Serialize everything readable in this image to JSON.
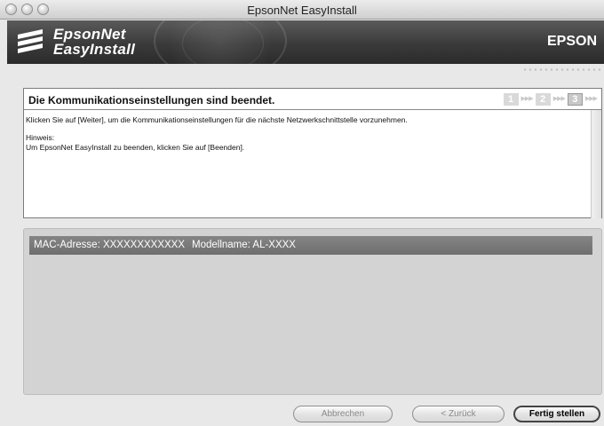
{
  "window": {
    "title": "EpsonNet EasyInstall"
  },
  "banner": {
    "brand_line1": "EpsonNet",
    "brand_line2": "EasyInstall",
    "vendor": "EPSON"
  },
  "panel": {
    "heading": "Die Kommunikationseinstellungen sind beendet.",
    "steps": [
      "1",
      "2",
      "3"
    ],
    "active_step": 3,
    "text_line1": "Klicken Sie auf [Weiter], um die Kommunikationseinstellungen für die nächste Netzwerkschnittstelle vorzunehmen.",
    "note_label": "Hinweis:",
    "note_text": "Um EpsonNet EasyInstall zu beenden, klicken Sie auf [Beenden]."
  },
  "device": {
    "mac": "MAC-Adresse: XXXXXXXXXXXX",
    "model": "Modellname: AL-XXXX"
  },
  "buttons": {
    "cancel": "Abbrechen",
    "back": "< Zurück",
    "finish": "Fertig stellen"
  }
}
